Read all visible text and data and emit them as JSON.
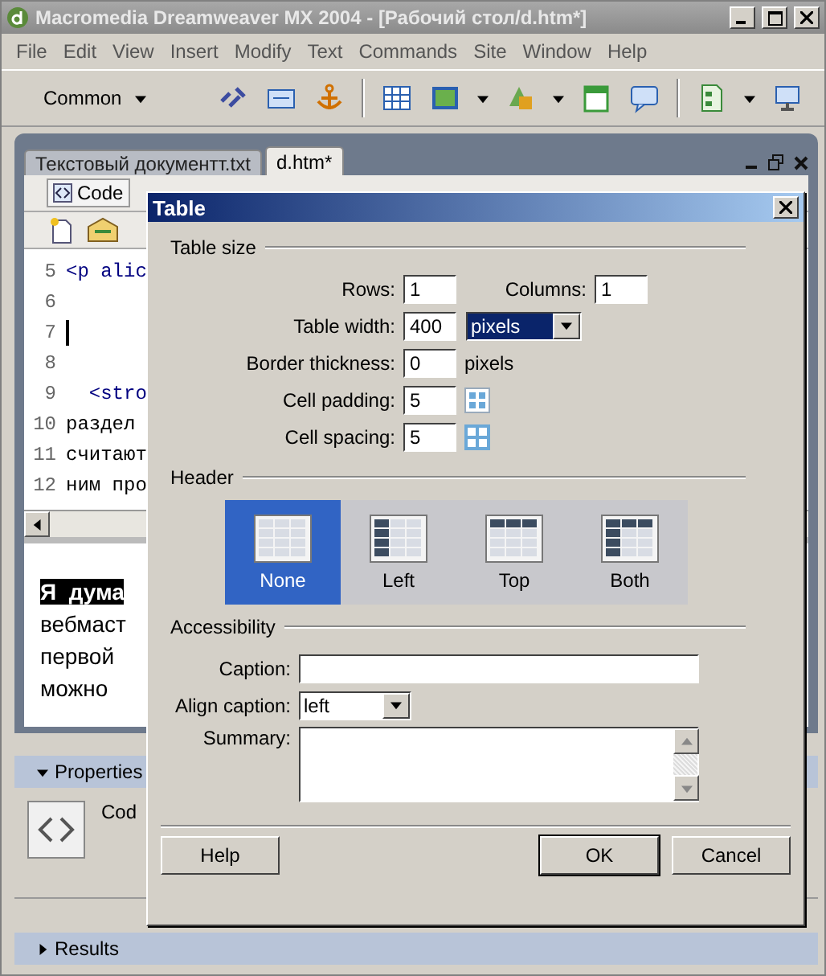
{
  "window": {
    "title": "Macromedia Dreamweaver MX 2004 - [Рабочий стол/d.htm*]"
  },
  "menu": [
    "File",
    "Edit",
    "View",
    "Insert",
    "Modify",
    "Text",
    "Commands",
    "Site",
    "Window",
    "Help"
  ],
  "insert_bar": {
    "category": "Common"
  },
  "document_tabs": [
    {
      "label": "Текстовый документт.txt",
      "selected": false
    },
    {
      "label": "d.htm*",
      "selected": true
    }
  ],
  "document_toolbar": {
    "view_button": "Code"
  },
  "code_lines": [
    {
      "number": "5",
      "text": "<p alic",
      "caret": false
    },
    {
      "number": "6",
      "caret": false
    },
    {
      "number": "7",
      "caret": true
    },
    {
      "number": "8",
      "caret": false
    },
    {
      "number": "9",
      "text": "  <stro",
      "caret": false
    },
    {
      "number": "10",
      "text": "раздел",
      "caret": false
    },
    {
      "number": "11",
      "text": "считают",
      "caret": false
    },
    {
      "number": "12",
      "text": "ним про",
      "caret": false
    }
  ],
  "design_lines": [
    {
      "text": "Я  дума",
      "highlighted": true
    },
    {
      "text": "вебмаст",
      "highlighted": false
    },
    {
      "text": "первой",
      "highlighted": false
    },
    {
      "text": "можно",
      "highlighted": false
    }
  ],
  "properties": {
    "title": "Properties",
    "expanded": true,
    "label": "Cod"
  },
  "results": {
    "title": "Results",
    "expanded": false
  },
  "dialog": {
    "title": "Table",
    "table_size": {
      "legend": "Table size",
      "rows": {
        "label": "Rows:",
        "value": "1"
      },
      "columns": {
        "label": "Columns:",
        "value": "1"
      },
      "table_width": {
        "label": "Table width:",
        "value": "400",
        "unit": "pixels"
      },
      "border_thickness": {
        "label": "Border thickness:",
        "value": "0",
        "unit": "pixels"
      },
      "cell_padding": {
        "label": "Cell padding:",
        "value": "5"
      },
      "cell_spacing": {
        "label": "Cell spacing:",
        "value": "5"
      }
    },
    "header": {
      "legend": "Header",
      "options": [
        {
          "label": "None",
          "kind": "none",
          "selected": true
        },
        {
          "label": "Left",
          "kind": "left",
          "selected": false
        },
        {
          "label": "Top",
          "kind": "top",
          "selected": false
        },
        {
          "label": "Both",
          "kind": "both",
          "selected": false
        }
      ]
    },
    "accessibility": {
      "legend": "Accessibility",
      "caption": {
        "label": "Caption:"
      },
      "align_caption": {
        "label": "Align caption:",
        "value": "left"
      },
      "summary": {
        "label": "Summary:"
      }
    },
    "buttons": [
      {
        "label": "Help",
        "kind": "help"
      },
      {
        "label": "OK",
        "kind": "default"
      },
      {
        "label": "Cancel",
        "kind": "cancel"
      }
    ]
  }
}
